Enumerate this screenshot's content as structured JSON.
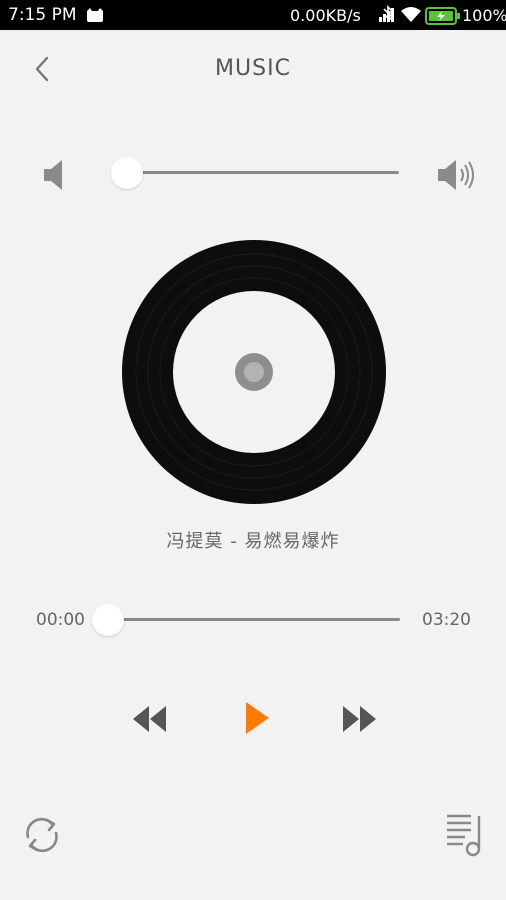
{
  "status_bar": {
    "time": "7:15 PM",
    "net_speed": "0.00KB/s",
    "battery_pct": "100%",
    "icons": [
      "cat-icon",
      "bluetooth-icon",
      "signal-icon",
      "wifi-icon",
      "battery-charging-icon"
    ],
    "battery_color": "#5ac236"
  },
  "header": {
    "title": "MUSIC",
    "back_icon": "chevron-left-icon"
  },
  "volume": {
    "level": 0.0,
    "low_icon": "volume-low-icon",
    "high_icon": "volume-high-icon"
  },
  "song": {
    "title": "冯提莫 - 易燃易爆炸"
  },
  "progress": {
    "current": "00:00",
    "duration": "03:20",
    "fraction": 0.0
  },
  "controls": {
    "rewind_icon": "rewind-icon",
    "play_icon": "play-icon",
    "forward_icon": "fast-forward-icon",
    "loop_icon": "repeat-icon",
    "playlist_icon": "playlist-icon",
    "accent": "#ff7a00"
  }
}
